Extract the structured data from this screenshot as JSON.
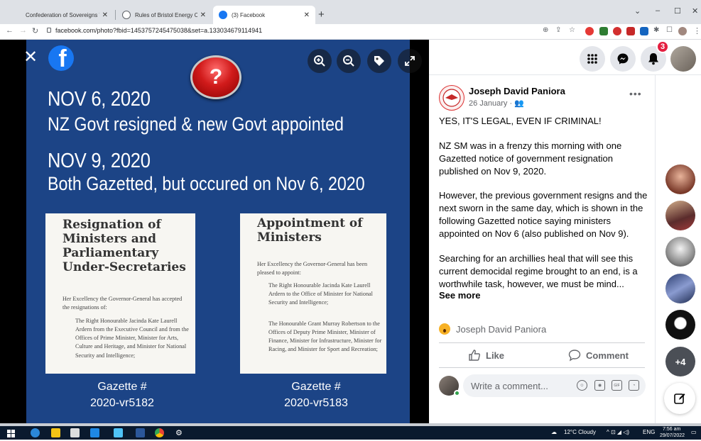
{
  "browser": {
    "tabs": [
      {
        "title": "Confederation of Sovereigns Wo",
        "active": false
      },
      {
        "title": "Rules of Bristol Energy Cooperati",
        "active": false
      },
      {
        "title": "(3) Facebook",
        "active": true
      }
    ],
    "new_tab": "+",
    "url": "facebook.com/photo?fbid=1453757245475038&set=a.133034679114941"
  },
  "viewer": {
    "close": "✕",
    "fb_logo": "f",
    "controls": [
      "zoom-in-icon",
      "zoom-out-icon",
      "tag-icon",
      "fullscreen-icon"
    ],
    "badge": "?"
  },
  "slide": {
    "date1": "NOV 6, 2020",
    "line1": "NZ Govt resigned & new Govt appointed",
    "date2": "NOV 9, 2020",
    "line2": "Both Gazetted, but occured on Nov 6, 2020",
    "left_card": {
      "title": "Resignation of Ministers and Parliamentary Under-Secretaries",
      "intro": "Her Excellency the Governor-General has accepted the resignations of:",
      "body": "The Right Honourable Jacinda Kate Laurell Ardern from the Executive Council and from the Offices of Prime Minister, Minister for Arts, Culture and Heritage, and Minister for National Security and Intelligence;"
    },
    "right_card": {
      "title": "Appointment of Ministers",
      "intro": "Her Excellency the Governor-General has been pleased to appoint:",
      "body1": "The Right Honourable Jacinda Kate Laurell Ardern to the Office of Minister for National Security and Intelligence;",
      "body2": "The Honourable Grant Murray Robertson to the Offices of Deputy Prime Minister, Minister of Finance, Minister for Infrastructure, Minister for Racing, and Minister for Sport and Recreation;"
    },
    "gazette_left": [
      "Gazette #",
      "2020-vr5182"
    ],
    "gazette_right": [
      "Gazette #",
      "2020-vr5183"
    ]
  },
  "topbar": {
    "notification_count": "3"
  },
  "post": {
    "author": "Joseph David Paniora",
    "meta": "26 January · 👥",
    "more": "•••",
    "para1": "YES, IT'S LEGAL, EVEN IF CRIMINAL!",
    "para2": "NZ SM was in a frenzy this morning with one Gazetted notice of government resignation published on Nov 9, 2020.",
    "para3": "However, the previous government resigns and the next sworn in the same day, which is shown in the following Gazetted notice saying ministers appointed on Nov 6 (also published on Nov 9).",
    "para4": "Searching for an archillies heal that will see this current democidal regime brought to an end, is a worthwhile task, however, we must be mind...",
    "see_more": "See more",
    "reaction_name": "Joseph David Paniora",
    "like_label": "Like",
    "comment_label": "Comment",
    "comment_placeholder": "Write a comment..."
  },
  "contacts": {
    "more_label": "+4"
  },
  "taskbar": {
    "weather": "12°C  Cloudy",
    "lang": "ENG",
    "time": "7:56 am",
    "date": "29/07/2022"
  },
  "colors": {
    "slide_bg": "#1c4486",
    "fb_blue": "#1877f2",
    "badge_red": "#e41e3f"
  }
}
